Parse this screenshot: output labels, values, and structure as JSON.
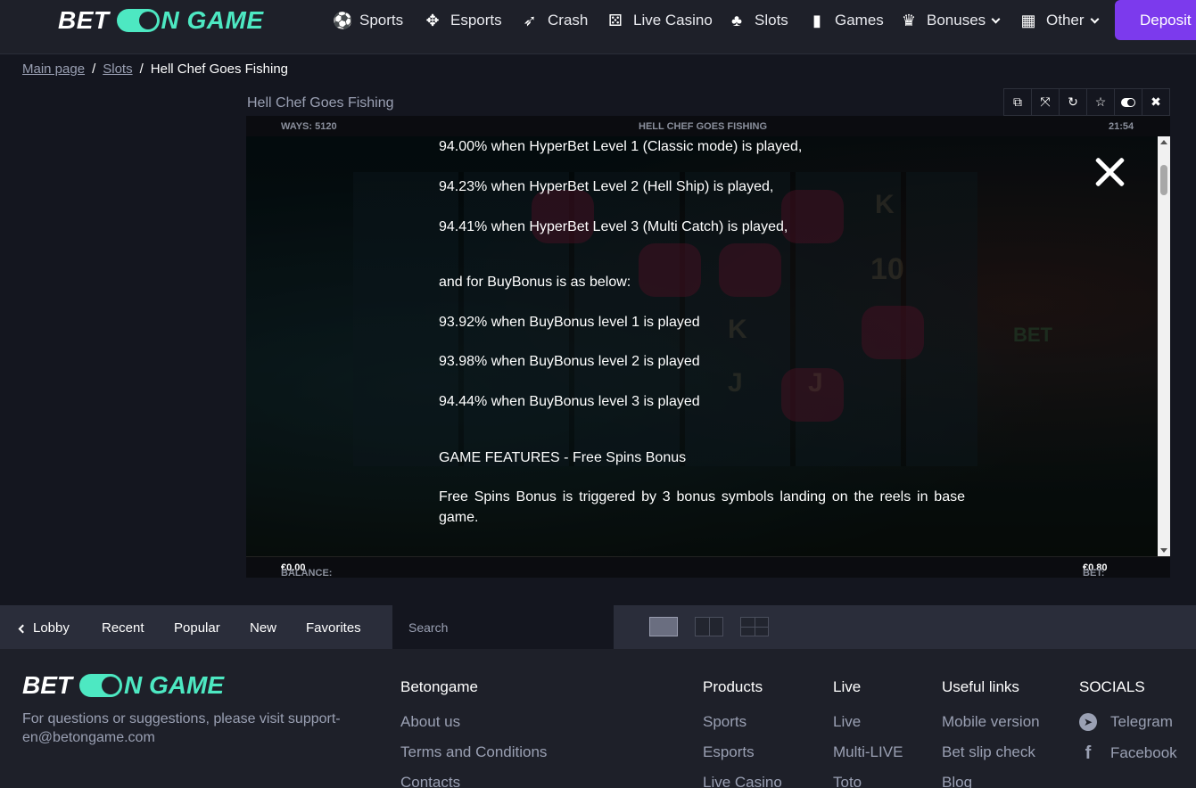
{
  "header": {
    "logo": {
      "part1": "BET",
      "part2": "N GAME"
    },
    "nav": [
      {
        "label": "Sports",
        "icon": "soccer-ball-icon",
        "glyph": "⚽"
      },
      {
        "label": "Esports",
        "icon": "esports-icon",
        "glyph": "✥"
      },
      {
        "label": "Crash",
        "icon": "rocket-icon",
        "glyph": "🚀"
      },
      {
        "label": "Live Casino",
        "icon": "dice-icon",
        "glyph": "⚄"
      },
      {
        "label": "Slots",
        "icon": "cherry-icon",
        "glyph": "🍒"
      },
      {
        "label": "Games",
        "icon": "cards-icon",
        "glyph": "🂠"
      },
      {
        "label": "Bonuses",
        "icon": "crown-icon",
        "glyph": "♛"
      },
      {
        "label": "Other",
        "icon": "grid-icon",
        "glyph": "▦"
      }
    ],
    "deposit": "Deposit"
  },
  "breadcrumb": {
    "home": "Main page",
    "section": "Slots",
    "current": "Hell Chef Goes Fishing"
  },
  "game": {
    "title": "Hell Chef Goes Fishing",
    "top_left": "WAYS: 5120",
    "top_center": "HELL CHEF GOES FISHING",
    "top_right": "21:54",
    "balance_label": "BALANCE:",
    "balance_value": "€0.00",
    "bet_label": "BET:",
    "bet_value": "€0.80",
    "info_lines": [
      "94.00% when HyperBet Level 1 (Classic mode) is played,",
      "94.23% when HyperBet Level 2 (Hell Ship) is played,",
      "94.41% when HyperBet Level 3 (Multi Catch) is played,",
      "and for BuyBonus is as below:",
      "93.92% when BuyBonus level 1 is played",
      "93.98% when BuyBonus level 2 is played",
      "94.44% when BuyBonus level 3 is played",
      "GAME FEATURES - Free Spins Bonus",
      "Free Spins Bonus is triggered by 3 bonus symbols landing on the reels in base game."
    ]
  },
  "lobby": {
    "tabs": [
      "Lobby",
      "Recent",
      "Popular",
      "New",
      "Favorites"
    ],
    "search_placeholder": "Search"
  },
  "footer": {
    "support_text": "For questions or suggestions, please visit support-en@betongame.com",
    "columns": [
      {
        "title": "Betongame",
        "links": [
          "About us",
          "Terms and Conditions",
          "Contacts"
        ]
      },
      {
        "title": "Products",
        "links": [
          "Sports",
          "Esports",
          "Live Casino"
        ]
      },
      {
        "title": "Live",
        "links": [
          "Live",
          "Multi-LIVE",
          "Toto"
        ]
      },
      {
        "title": "Useful links",
        "links": [
          "Mobile version",
          "Bet slip check",
          "Blog"
        ]
      },
      {
        "title": "SOCIALS",
        "links": [
          "Telegram",
          "Facebook"
        ]
      }
    ]
  },
  "colors": {
    "accent": "#4de8c2",
    "deposit": "#7c3aed"
  }
}
